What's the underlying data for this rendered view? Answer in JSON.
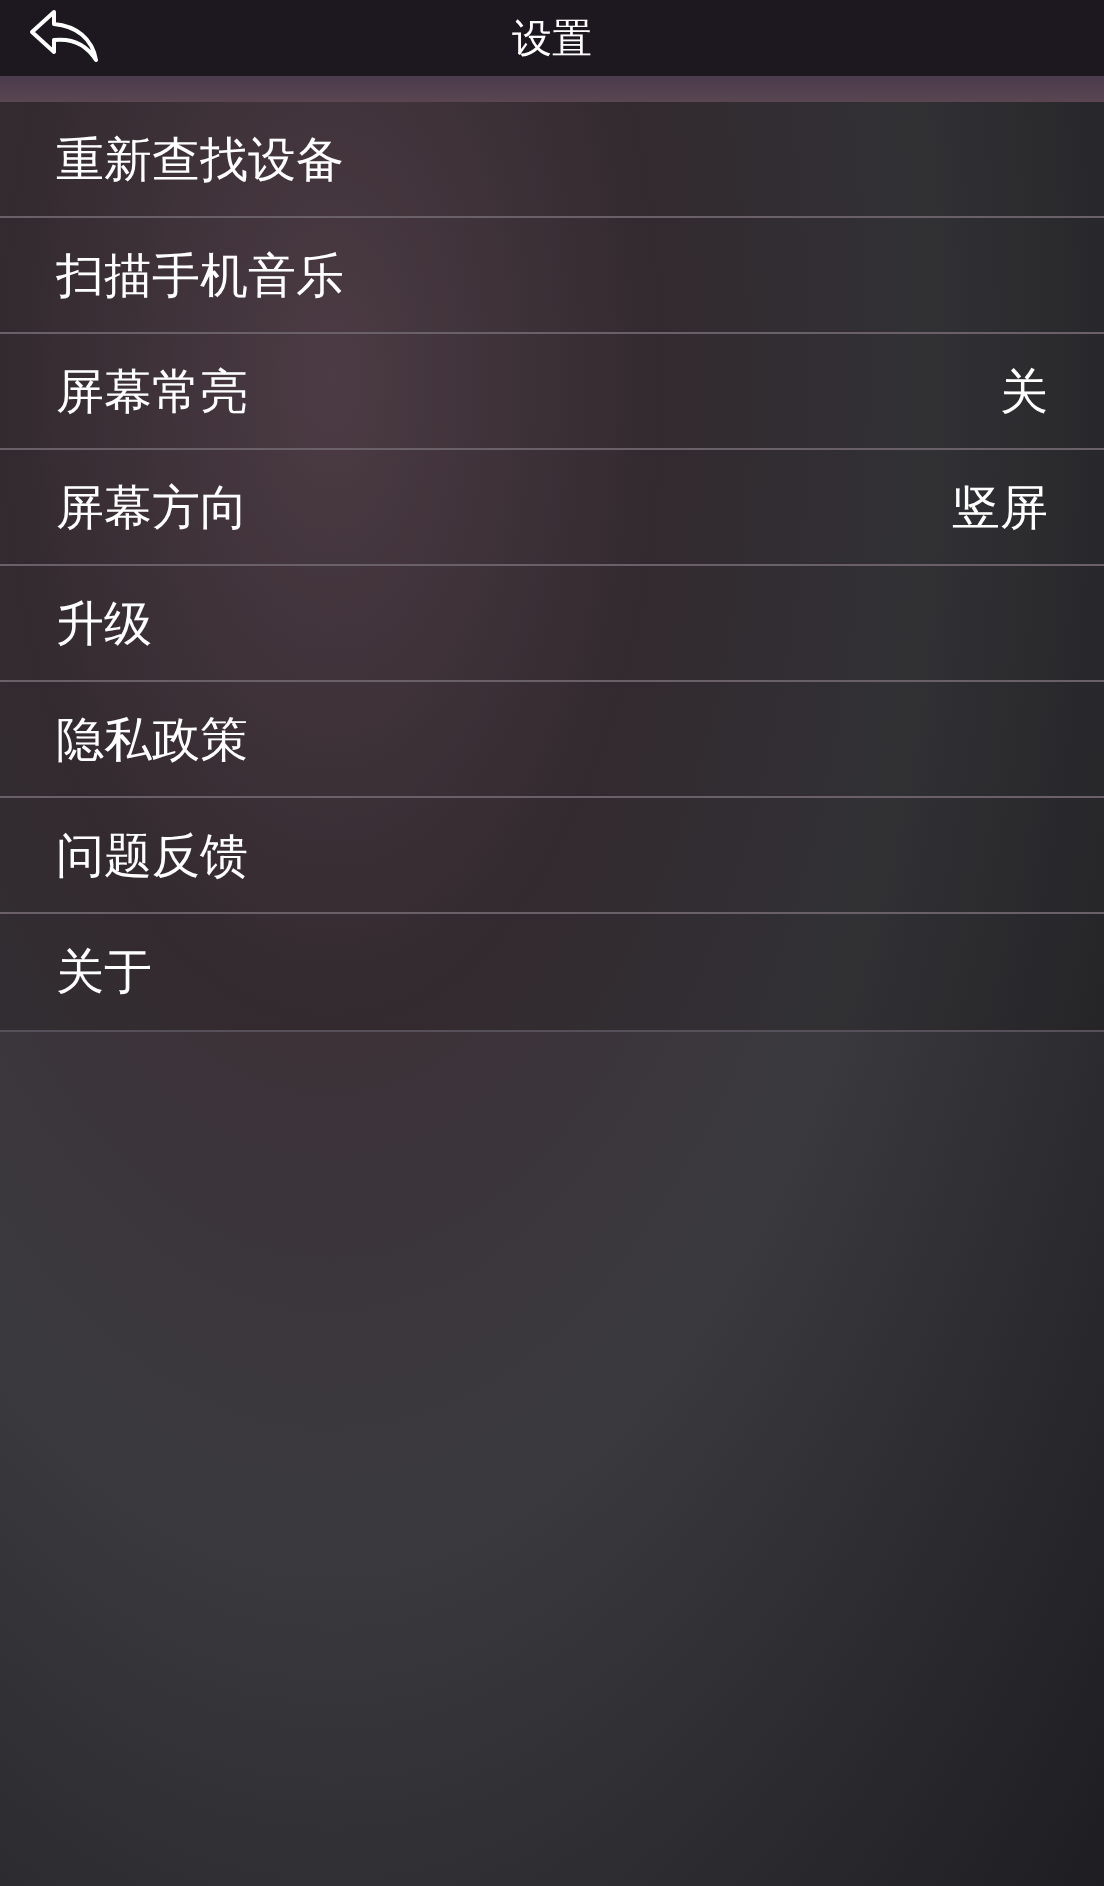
{
  "header": {
    "title": "设置"
  },
  "items": [
    {
      "label": "重新查找设备"
    },
    {
      "label": "扫描手机音乐"
    },
    {
      "label": "屏幕常亮",
      "value": "关"
    },
    {
      "label": "屏幕方向",
      "value": "竖屏"
    },
    {
      "label": "升级"
    },
    {
      "label": "隐私政策"
    },
    {
      "label": "问题反馈"
    },
    {
      "label": "关于"
    }
  ]
}
